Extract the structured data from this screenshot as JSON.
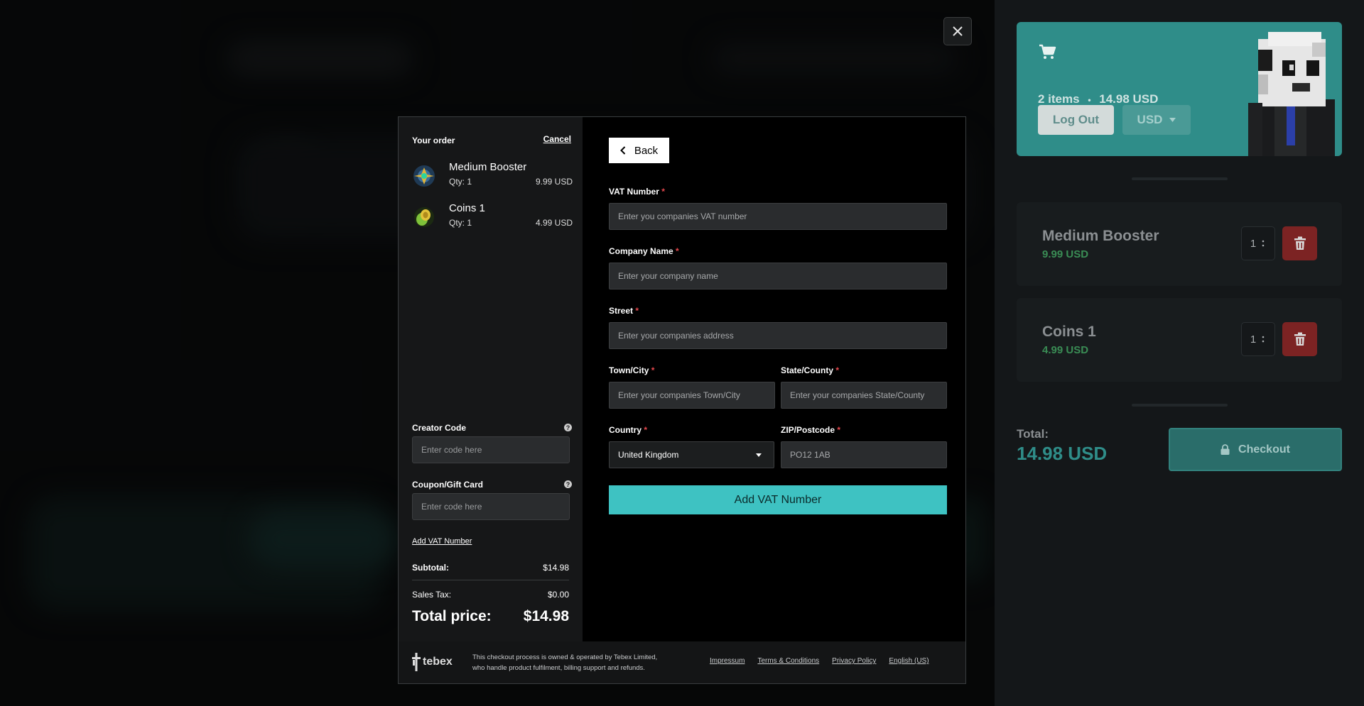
{
  "cart_panel": {
    "item_count": "2 items",
    "separator": "•",
    "total_amount": "14.98 USD",
    "logout_label": "Log Out",
    "currency_label": "USD",
    "items": [
      {
        "name": "Medium Booster",
        "price": "9.99 USD",
        "qty": "1"
      },
      {
        "name": "Coins 1",
        "price": "4.99 USD",
        "qty": "1"
      }
    ],
    "total_label": "Total:",
    "total_value": "14.98 USD",
    "checkout_label": "Checkout",
    "colors": {
      "accent": "#2f8d89",
      "price_green": "#3a8d55",
      "delete_red": "#7c2323"
    }
  },
  "modal": {
    "order": {
      "title": "Your order",
      "cancel_label": "Cancel",
      "items": [
        {
          "name": "Medium Booster",
          "qty": "Qty: 1",
          "price": "9.99 USD"
        },
        {
          "name": "Coins 1",
          "qty": "Qty: 1",
          "price": "4.99 USD"
        }
      ],
      "creator_code_label": "Creator Code",
      "creator_code_placeholder": "Enter code here",
      "coupon_label": "Coupon/Gift Card",
      "coupon_placeholder": "Enter code here",
      "help_glyph": "?",
      "add_vat_link": "Add VAT Number",
      "subtotal_label": "Subtotal:",
      "subtotal_value": "$14.98",
      "tax_label": "Sales Tax:",
      "tax_value": "$0.00",
      "total_label": "Total price:",
      "total_value": "$14.98"
    },
    "form": {
      "back_label": "Back",
      "required_mark": "*",
      "vat_label": "VAT Number",
      "vat_placeholder": "Enter you companies VAT number",
      "company_label": "Company Name",
      "company_placeholder": "Enter your company name",
      "street_label": "Street",
      "street_placeholder": "Enter your companies address",
      "town_label": "Town/City",
      "town_placeholder": "Enter your companies Town/City",
      "state_label": "State/County",
      "state_placeholder": "Enter your companies State/County",
      "country_label": "Country",
      "country_value": "United Kingdom",
      "zip_label": "ZIP/Postcode",
      "zip_placeholder": "PO12 1AB",
      "submit_label": "Add VAT Number",
      "accent": "#3ec2c2"
    },
    "footer": {
      "brand": "tebex",
      "notice_line1": "This checkout process is owned & operated by Tebex Limited,",
      "notice_line2": "who handle product fulfilment, billing support and refunds.",
      "links": [
        "Impressum",
        "Terms & Conditions",
        "Privacy Policy",
        "English (US)"
      ]
    }
  }
}
